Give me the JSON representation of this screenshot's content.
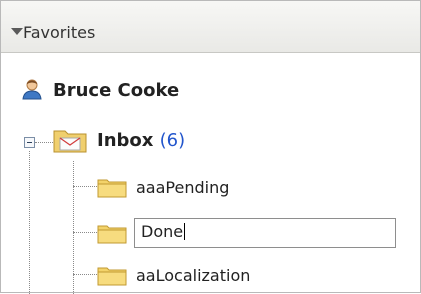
{
  "favorites": {
    "title": "Favorites",
    "user": {
      "name": "Bruce Cooke",
      "icon": "user-icon"
    },
    "inbox": {
      "label": "Inbox",
      "count": "(6)",
      "icon": "inbox-folder-icon",
      "expanded": true
    },
    "folders": [
      {
        "label": "aaaPending",
        "icon": "folder-icon"
      },
      {
        "label": "Done",
        "icon": "folder-icon",
        "editing": true
      },
      {
        "label": "aaLocalization",
        "icon": "folder-icon"
      }
    ]
  },
  "colors": {
    "header_bg": "#eeeeec",
    "count_blue": "#2255cc",
    "folder_yellow": "#f3d36a"
  }
}
